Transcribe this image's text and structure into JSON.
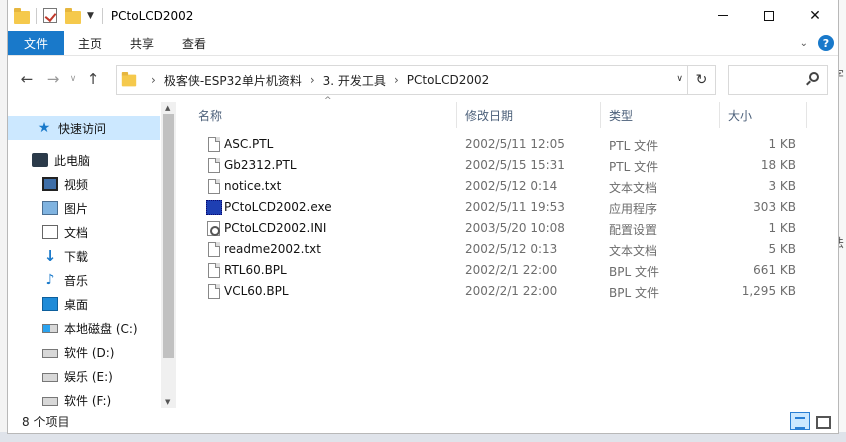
{
  "window": {
    "title": "PCtoLCD2002"
  },
  "ribbon": {
    "tabs": [
      "文件",
      "主页",
      "共享",
      "查看"
    ]
  },
  "address": {
    "crumbs": [
      "极客侠-ESP32单片机资料",
      "3. 开发工具",
      "PCtoLCD2002"
    ]
  },
  "sidebar": {
    "quick_access": "快速访问",
    "this_pc": "此电脑",
    "items": [
      "视频",
      "图片",
      "文档",
      "下载",
      "音乐",
      "桌面",
      "本地磁盘 (C:)",
      "软件 (D:)",
      "娱乐 (E:)",
      "软件 (F:)"
    ]
  },
  "columns": {
    "name": "名称",
    "date": "修改日期",
    "type": "类型",
    "size": "大小"
  },
  "files": [
    {
      "name": "ASC.PTL",
      "date": "2002/5/11 12:05",
      "type": "PTL 文件",
      "size": "1 KB"
    },
    {
      "name": "Gb2312.PTL",
      "date": "2002/5/15 15:31",
      "type": "PTL 文件",
      "size": "18 KB"
    },
    {
      "name": "notice.txt",
      "date": "2002/5/12 0:14",
      "type": "文本文档",
      "size": "3 KB"
    },
    {
      "name": "PCtoLCD2002.exe",
      "date": "2002/5/11 19:53",
      "type": "应用程序",
      "size": "303 KB"
    },
    {
      "name": "PCtoLCD2002.INI",
      "date": "2003/5/20 10:08",
      "type": "配置设置",
      "size": "1 KB"
    },
    {
      "name": "readme2002.txt",
      "date": "2002/5/12 0:13",
      "type": "文本文档",
      "size": "5 KB"
    },
    {
      "name": "RTL60.BPL",
      "date": "2002/2/1 22:00",
      "type": "BPL 文件",
      "size": "661 KB"
    },
    {
      "name": "VCL60.BPL",
      "date": "2002/2/1 22:00",
      "type": "BPL 文件",
      "size": "1,295 KB"
    }
  ],
  "status": {
    "count": "8 个项目"
  },
  "icons": {
    "accent": "#1979ca",
    "selection": "#cce8ff"
  }
}
